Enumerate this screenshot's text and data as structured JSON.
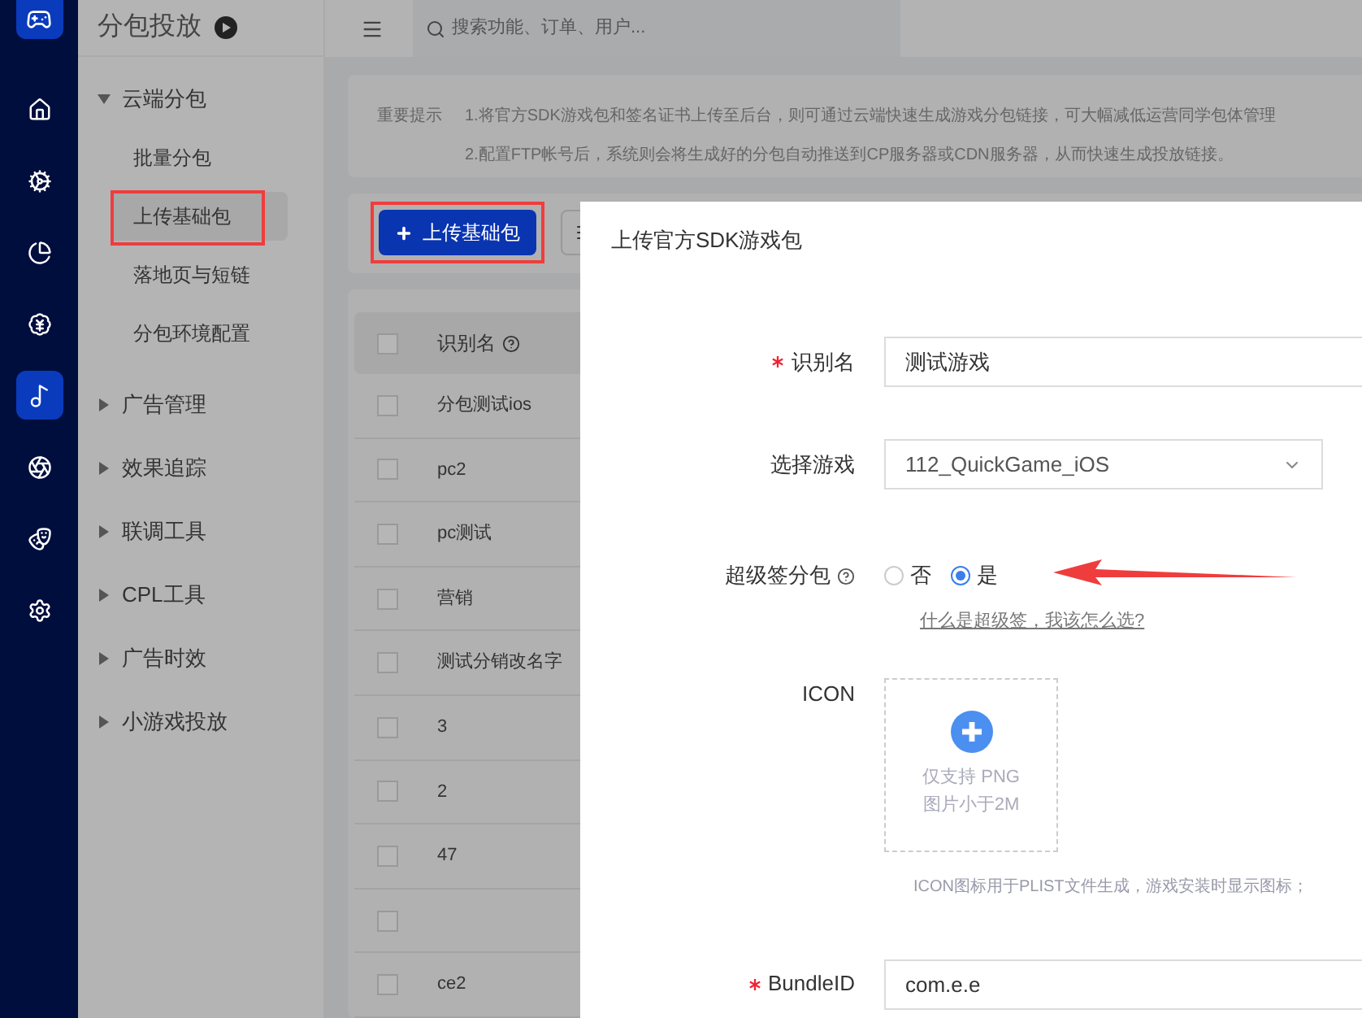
{
  "rail": {
    "items": [
      {
        "kind": "home",
        "selected": false
      },
      {
        "kind": "gears",
        "selected": false
      },
      {
        "kind": "pie",
        "selected": false
      },
      {
        "kind": "yen",
        "selected": false
      },
      {
        "kind": "music",
        "selected": true
      },
      {
        "kind": "aperture",
        "selected": false
      },
      {
        "kind": "mask",
        "selected": false
      },
      {
        "kind": "settings",
        "selected": false
      }
    ]
  },
  "sidebar": {
    "title": "分包投放",
    "groups": [
      {
        "label": "云端分包",
        "expanded": true,
        "children": [
          {
            "label": "批量分包",
            "selected": false,
            "highlighted": false
          },
          {
            "label": "上传基础包",
            "selected": true,
            "highlighted": true
          },
          {
            "label": "落地页与短链",
            "selected": false,
            "highlighted": false
          },
          {
            "label": "分包环境配置",
            "selected": false,
            "highlighted": false
          }
        ]
      },
      {
        "label": "广告管理",
        "expanded": false
      },
      {
        "label": "效果追踪",
        "expanded": false
      },
      {
        "label": "联调工具",
        "expanded": false
      },
      {
        "label": "CPL工具",
        "expanded": false
      },
      {
        "label": "广告时效",
        "expanded": false
      },
      {
        "label": "小游戏投放",
        "expanded": false
      }
    ]
  },
  "topbar": {
    "search": {
      "placeholder": "搜索功能、订单、用户..."
    }
  },
  "notice": {
    "label": "重要提示",
    "lines": [
      "1.将官方SDK游戏包和签名证书上传至后台，则可通过云端快速生成游戏分包链接，可大幅减低运营同学包体管理",
      "2.配置FTP帐号后，系统则会将生成好的分包自动推送到CP服务器或CDN服务器，从而快速生成投放链接。"
    ]
  },
  "toolbar": {
    "upload_button": {
      "label": "上传基础包",
      "highlighted": true
    }
  },
  "table": {
    "all_checked": false,
    "columns": [
      "识别名"
    ],
    "rows": [
      {
        "name": "分包测试ios",
        "checked": false
      },
      {
        "name": "pc2",
        "checked": false
      },
      {
        "name": "pc测试",
        "checked": false
      },
      {
        "name": "营销",
        "checked": false
      },
      {
        "name": "测试分销改名字",
        "checked": false
      },
      {
        "name": "3",
        "checked": false
      },
      {
        "name": "2",
        "checked": false
      },
      {
        "name": "47",
        "checked": false
      },
      {
        "name": "",
        "checked": false
      },
      {
        "name": "ce2",
        "checked": false
      }
    ]
  },
  "modal": {
    "title": "上传官方SDK游戏包",
    "fields": [
      {
        "kind": "text",
        "label": "识别名",
        "required": true,
        "value": "测试游戏"
      },
      {
        "kind": "select",
        "label": "选择游戏",
        "required": false,
        "value": "112_QuickGame_iOS"
      },
      {
        "kind": "radio",
        "label": "超级签分包",
        "required": false,
        "help": true,
        "options": [
          {
            "label": "否",
            "selected": false
          },
          {
            "label": "是",
            "selected": true
          }
        ],
        "link": "什么是超级签，我该怎么选?"
      },
      {
        "kind": "upload",
        "label": "ICON",
        "required": false,
        "lines": [
          "仅支持 PNG",
          "图片小于2M"
        ],
        "hint": "ICON图标用于PLIST文件生成，游戏安装时显示图标；"
      },
      {
        "kind": "text",
        "label": "BundleID",
        "required": true,
        "value": "com.e.e"
      }
    ]
  }
}
